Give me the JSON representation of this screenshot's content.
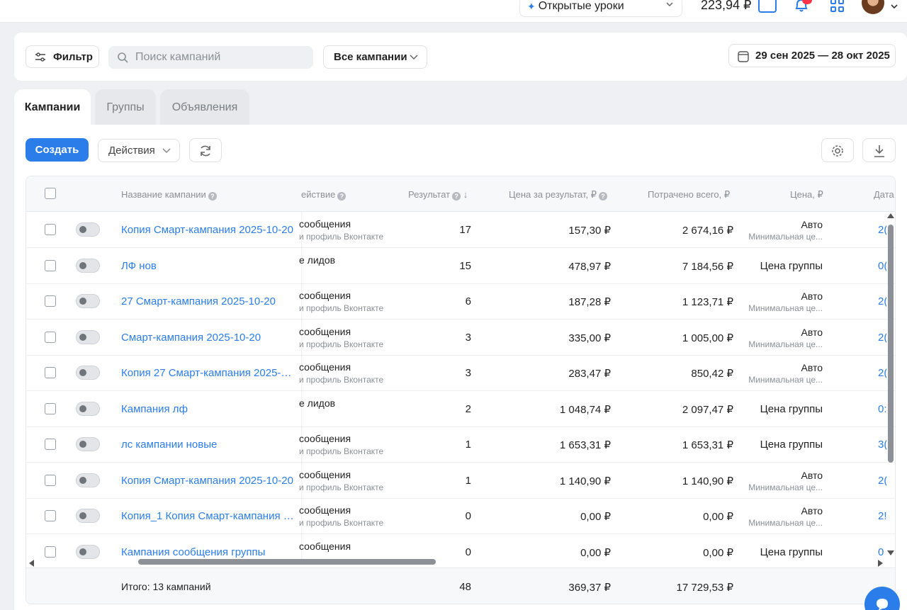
{
  "topbar": {
    "open_lessons": "Открытые уроки",
    "balance": "223,94 ₽"
  },
  "filter": {
    "filter_label": "Фильтр",
    "search_placeholder": "Поиск кампаний",
    "all_campaigns": "Все кампании",
    "date_range": "29 сен 2025 — 28 окт 2025"
  },
  "tabs": [
    "Кампании",
    "Группы",
    "Объявления"
  ],
  "toolbar": {
    "create": "Создать",
    "actions": "Действия"
  },
  "table": {
    "headers": {
      "name": "Название кампании",
      "objective": "ействие",
      "result": "Результат",
      "price_per_result": "Цена за результат, ₽",
      "spent": "Потрачено всего, ₽",
      "bid": "Цена, ₽",
      "date": "Дата"
    },
    "rows": [
      {
        "name": "Копия Смарт-кампания 2025-10-20",
        "objective": "сообщения",
        "objective_sub": "и профиль Вконтакте",
        "result": "17",
        "price": "157,30 ₽",
        "spent": "2 674,16 ₽",
        "bid": "Авто",
        "bid_sub": "Минимальная це...",
        "date": "2("
      },
      {
        "name": "ЛФ нов",
        "objective": "е лидов",
        "objective_sub": "",
        "result": "15",
        "price": "478,97 ₽",
        "spent": "7 184,56 ₽",
        "bid": "Цена группы",
        "bid_sub": "",
        "date": "0("
      },
      {
        "name": "27 Смарт-кампания 2025-10-20",
        "objective": "сообщения",
        "objective_sub": "и профиль Вконтакте",
        "result": "6",
        "price": "187,28 ₽",
        "spent": "1 123,71 ₽",
        "bid": "Авто",
        "bid_sub": "Минимальная це...",
        "date": "2("
      },
      {
        "name": "Смарт-кампания 2025-10-20",
        "objective": "сообщения",
        "objective_sub": "и профиль Вконтакте",
        "result": "3",
        "price": "335,00 ₽",
        "spent": "1 005,00 ₽",
        "bid": "Авто",
        "bid_sub": "Минимальная це...",
        "date": "2("
      },
      {
        "name": "Копия 27 Смарт-кампания 2025-1...",
        "objective": "сообщения",
        "objective_sub": "и профиль Вконтакте",
        "result": "3",
        "price": "283,47 ₽",
        "spent": "850,42 ₽",
        "bid": "Авто",
        "bid_sub": "Минимальная це...",
        "date": "2("
      },
      {
        "name": "Кампания лф",
        "objective": "е лидов",
        "objective_sub": "",
        "result": "2",
        "price": "1 048,74 ₽",
        "spent": "2 097,47 ₽",
        "bid": "Цена группы",
        "bid_sub": "",
        "date": "0:"
      },
      {
        "name": "лс кампании новые",
        "objective": "сообщения",
        "objective_sub": "и профиль Вконтакте",
        "result": "1",
        "price": "1 653,31 ₽",
        "spent": "1 653,31 ₽",
        "bid": "Цена группы",
        "bid_sub": "",
        "date": "3("
      },
      {
        "name": "Копия Смарт-кампания 2025-10-20",
        "objective": "сообщения",
        "objective_sub": "и профиль Вконтакте",
        "result": "1",
        "price": "1 140,90 ₽",
        "spent": "1 140,90 ₽",
        "bid": "Авто",
        "bid_sub": "Минимальная це...",
        "date": "2("
      },
      {
        "name": "Копия_1 Копия Смарт-кампания 2...",
        "objective": "сообщения",
        "objective_sub": "и профиль Вконтакте",
        "result": "0",
        "price": "0,00 ₽",
        "spent": "0,00 ₽",
        "bid": "Авто",
        "bid_sub": "Минимальная це...",
        "date": "2!"
      },
      {
        "name": "Кампания сообщения группы",
        "objective": "сообщения",
        "objective_sub": "",
        "result": "0",
        "price": "0,00 ₽",
        "spent": "0,00 ₽",
        "bid": "Цена группы",
        "bid_sub": "",
        "date": "0"
      }
    ],
    "footer": {
      "total_label": "Итого: 13 кампаний",
      "result": "48",
      "price": "369,37 ₽",
      "spent": "17 729,53 ₽"
    }
  },
  "colors": {
    "accent": "#2b7de9",
    "badge": "#ff3347"
  }
}
